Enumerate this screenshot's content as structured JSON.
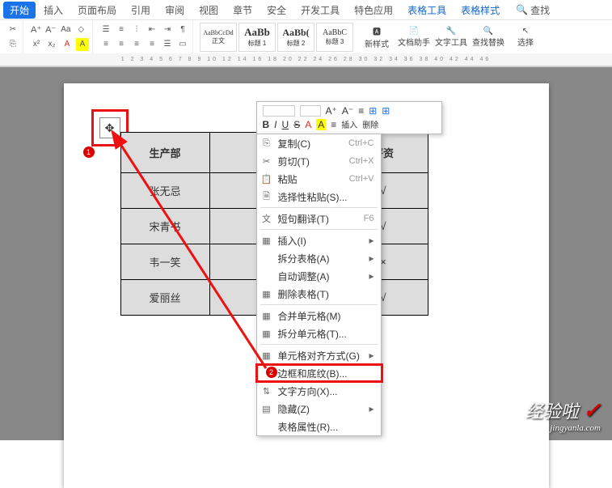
{
  "tabs": {
    "start": "开始",
    "insert": "插入",
    "layout": "页面布局",
    "refs": "引用",
    "review": "审阅",
    "view": "视图",
    "sections": "章节",
    "safety": "安全",
    "dev": "开发工具",
    "special": "特色应用",
    "tbl_tools": "表格工具",
    "tbl_style": "表格样式",
    "search_label": "查找"
  },
  "styles": {
    "s1": {
      "prev": "AaBbCcDd",
      "name": "正文"
    },
    "s2": {
      "prev": "AaBb",
      "name": "标题 1"
    },
    "s3": {
      "prev": "AaBb(",
      "name": "标题 2"
    },
    "s4": {
      "prev": "AaBbC",
      "name": "标题 3"
    },
    "new_style": "新样式"
  },
  "big_buttons": {
    "assist": "文档助手",
    "tools": "文字工具",
    "findrep": "查找替换",
    "select": "选择"
  },
  "table": {
    "col1": "生产部",
    "col3": "薪资",
    "r1": "张无忌",
    "r2": "宋青书",
    "r3": "韦一笑",
    "r4": "爱丽丝",
    "mark": "√",
    "x": "×"
  },
  "mini": {
    "b": "B",
    "i": "I",
    "u": "U",
    "s": "S",
    "a": "A",
    "insert": "插入",
    "delete": "删除"
  },
  "ctx": {
    "copy": {
      "t": "复制(C)",
      "k": "Ctrl+C"
    },
    "cut": {
      "t": "剪切(T)",
      "k": "Ctrl+X"
    },
    "paste": {
      "t": "粘贴",
      "k": "Ctrl+V"
    },
    "paste_sp": "选择性粘贴(S)...",
    "trans": {
      "t": "短句翻译(T)",
      "k": "F6"
    },
    "insert": "插入(I)",
    "split_tbl": "拆分表格(A)",
    "auto": "自动调整(A)",
    "del_tbl": "删除表格(T)",
    "merge": "合并单元格(M)",
    "split_cell": "拆分单元格(T)...",
    "align": "单元格对齐方式(G)",
    "border": "边框和底纹(B)...",
    "text_dir": "文字方向(X)...",
    "hide": "隐藏(Z)",
    "props": "表格属性(R)..."
  },
  "annot": {
    "m1": "1",
    "m2": "2"
  },
  "watermark": {
    "l1": "经验啦",
    "l2": "jingyanla.com"
  }
}
